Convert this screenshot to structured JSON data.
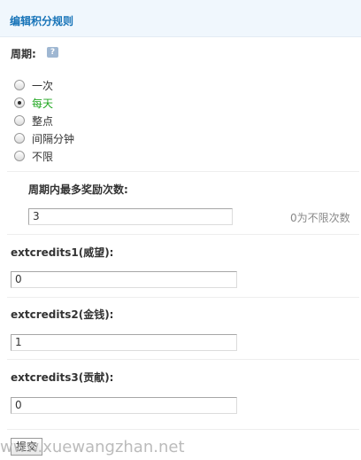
{
  "header": {
    "title": "编辑积分规则"
  },
  "period": {
    "label": "周期:",
    "help_icon": "question-icon",
    "options": [
      {
        "label": "一次",
        "selected": false
      },
      {
        "label": "每天",
        "selected": true
      },
      {
        "label": "整点",
        "selected": false
      },
      {
        "label": "间隔分钟",
        "selected": false
      },
      {
        "label": "不限",
        "selected": false
      }
    ]
  },
  "max_rewards": {
    "label": "周期内最多奖励次数:",
    "value": "3",
    "hint": "0为不限次数"
  },
  "credits": [
    {
      "label": "extcredits1(威望):",
      "value": "0"
    },
    {
      "label": "extcredits2(金钱):",
      "value": "1"
    },
    {
      "label": "extcredits3(贡献):",
      "value": "0"
    }
  ],
  "submit_label": "提交",
  "watermark": "www.xuewangzhan.net",
  "colors": {
    "header_bg": "#f0f7fd",
    "title": "#1673b8",
    "selected_option": "#22a722"
  }
}
